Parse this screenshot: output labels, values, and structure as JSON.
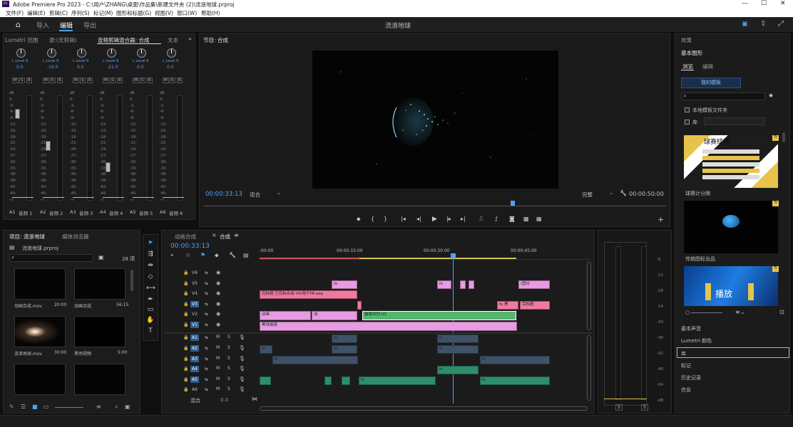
{
  "window": {
    "title": "Adobe Premiere Pro 2023 - C:\\用户\\ZHANG\\桌面\\作品集\\新建文件夹 (2)\\流浪地球.prproj",
    "app_icon": "Pr"
  },
  "menu": [
    "文件(F)",
    "编辑(E)",
    "剪辑(C)",
    "序列(S)",
    "标记(M)",
    "图形和标题(G)",
    "视图(V)",
    "窗口(W)",
    "帮助(H)"
  ],
  "appbar": {
    "tabs": [
      "导入",
      "编辑",
      "导出"
    ],
    "active": "编辑",
    "project_name": "流浪地球"
  },
  "mixer": {
    "tabs": [
      "Lumetri 范围",
      "源:(无剪辑)",
      "音频剪辑混合器: 合成",
      "文本"
    ],
    "channels": [
      {
        "lr": "L  Level  R",
        "val": "0.0",
        "track": "A1",
        "name": "音频 1"
      },
      {
        "lr": "L  Level  R",
        "val": "-10.0",
        "track": "A2",
        "name": "音频 2"
      },
      {
        "lr": "L  Level  R",
        "val": "0.0",
        "track": "A3",
        "name": "音频 3"
      },
      {
        "lr": "L  Level  R",
        "val": "-21.0",
        "track": "A4",
        "name": "音频 4"
      },
      {
        "lr": "L  Level  R",
        "val": "0.0",
        "track": "A5",
        "name": "音频 5"
      },
      {
        "lr": "L  Level  R",
        "val": "0.0",
        "track": "A6",
        "name": "音频 6"
      }
    ],
    "msr": [
      "M",
      "S",
      "R"
    ],
    "db_scale": [
      "dB",
      "0-",
      "-3-",
      "-6-",
      "-9-",
      "-12-",
      "-15-",
      "-18-",
      "-21-",
      "-24-",
      "-27-",
      "-30-",
      "-33-",
      "-36-",
      "-39-",
      "-42-",
      "-45-",
      "-∞"
    ]
  },
  "program": {
    "title": "节目: 合成",
    "timecode": "00:00:33:13",
    "fit": "适合",
    "quality": "完整",
    "duration": "00:00:50:00"
  },
  "project": {
    "tabs": [
      "项目: 流浪地球",
      "媒体浏览器"
    ],
    "file": "流浪地球.prproj",
    "count": "28 项",
    "items": [
      {
        "name": "动画合成.mov",
        "dur": "20:00"
      },
      {
        "name": "动画合成",
        "dur": "56:15"
      },
      {
        "name": "流浪地球.mov",
        "dur": "30:00"
      },
      {
        "name": "黑场视频",
        "dur": "5:00"
      }
    ]
  },
  "timeline": {
    "tabs": [
      "动画合成",
      "合成"
    ],
    "timecode": "00:00:33:13",
    "ruler": [
      ":00:00",
      "00:00:15:00",
      "00:00:30:00",
      "00:00:45:00"
    ],
    "video_tracks": [
      "V6",
      "V5",
      "V4",
      "V3",
      "V2",
      "V1"
    ],
    "audio_tracks": [
      "A1",
      "A2",
      "A3",
      "A4",
      "A5",
      "A6"
    ],
    "mix_label": "混合",
    "mix_val": "0.0",
    "clips": {
      "v4a": "完标题 已完标合成 04/用于PR.aep",
      "v3b": "完标题",
      "v2a": "动画",
      "v2b": "动",
      "v2seq": "嵌套序列 03",
      "v1": "黑场视频",
      "v5e": "(图分"
    }
  },
  "right_panel": {
    "header": "效果",
    "title": "基本图形",
    "tabs": [
      "浏览",
      "编辑"
    ],
    "my_templates": "我的模板",
    "local_folder": "本地模板文件夹",
    "lib": "库",
    "templates": [
      "球赛计分牌",
      "传统图标出品"
    ],
    "score_title": "球赛结果",
    "broadcast": "播放",
    "sections": [
      "基本声音",
      "Lumetri 颜色",
      "库",
      "标记",
      "历史记录",
      "信息"
    ]
  },
  "right_meter": {
    "scale": [
      "-6",
      "-12",
      "-18",
      "-24",
      "-30",
      "-36",
      "-42",
      "-48",
      "-54",
      "-dB"
    ],
    "s": [
      "S",
      "S"
    ]
  }
}
